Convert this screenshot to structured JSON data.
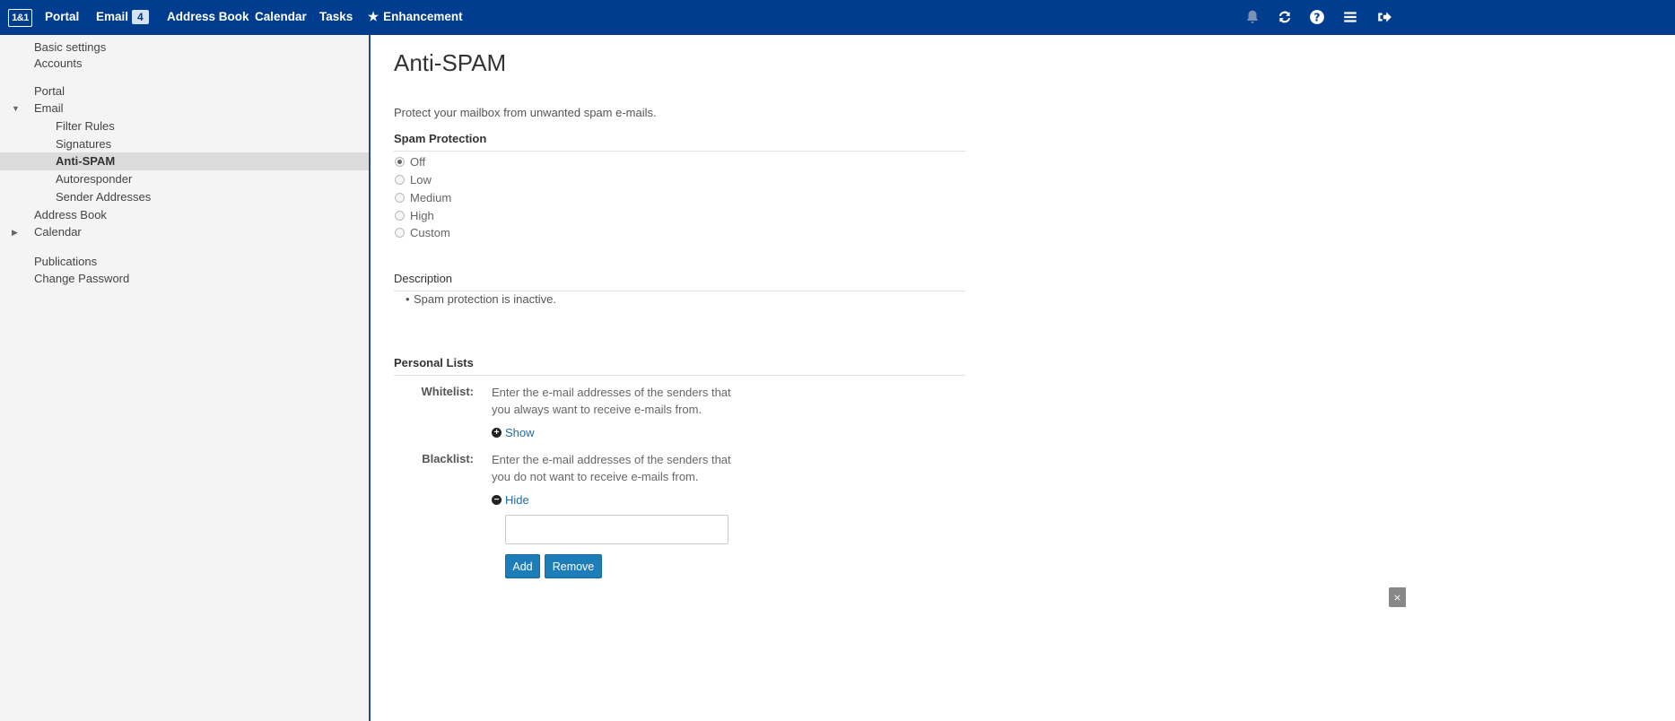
{
  "topbar": {
    "logo": "1&1",
    "nav": [
      {
        "label": "Portal"
      },
      {
        "label": "Email",
        "badge": "4"
      },
      {
        "label": "Address Book"
      },
      {
        "label": "Calendar"
      },
      {
        "label": "Tasks"
      },
      {
        "label": "Enhancement",
        "icon": "star-icon"
      }
    ],
    "icons": [
      "bell-icon",
      "refresh-icon",
      "help-icon",
      "menu-icon",
      "logout-icon"
    ]
  },
  "sidebar": {
    "items": [
      {
        "label": "Basic settings"
      },
      {
        "label": "Accounts"
      },
      {
        "label": "Portal"
      },
      {
        "label": "Email",
        "expanded": true
      },
      {
        "label": "Filter Rules"
      },
      {
        "label": "Signatures"
      },
      {
        "label": "Anti-SPAM",
        "selected": true
      },
      {
        "label": "Autoresponder"
      },
      {
        "label": "Sender Addresses"
      },
      {
        "label": "Address Book"
      },
      {
        "label": "Calendar",
        "expanded": false
      },
      {
        "label": "Publications"
      },
      {
        "label": "Change Password"
      }
    ]
  },
  "main": {
    "title": "Anti-SPAM",
    "intro": "Protect your mailbox from unwanted spam e-mails.",
    "spam_protection": {
      "heading": "Spam Protection",
      "options": [
        "Off",
        "Low",
        "Medium",
        "High",
        "Custom"
      ],
      "selected": "Off"
    },
    "description": {
      "heading": "Description",
      "items": [
        "Spam protection is inactive."
      ]
    },
    "personal_lists": {
      "heading": "Personal Lists",
      "whitelist": {
        "label": "Whitelist:",
        "text": "Enter the e-mail addresses of the senders that you always want to receive e-mails from.",
        "toggle": "Show"
      },
      "blacklist": {
        "label": "Blacklist:",
        "text": "Enter the e-mail addresses of the senders that you do not want to receive e-mails from.",
        "toggle": "Hide",
        "input_value": "",
        "add_label": "Add",
        "remove_label": "Remove"
      }
    }
  },
  "colors": {
    "topbar": "#003d8f",
    "sidebar_bg": "#f4f4f4",
    "button": "#1d7db8",
    "link": "#1f6ca8"
  }
}
